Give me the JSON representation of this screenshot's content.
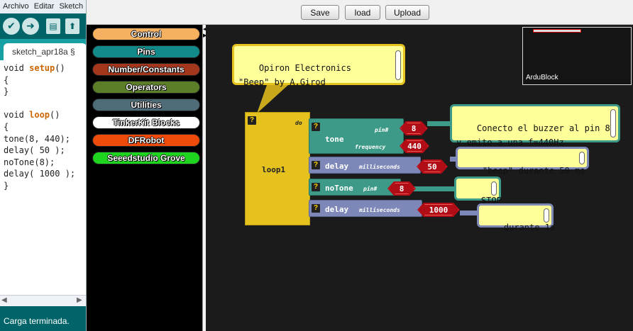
{
  "ide": {
    "menu": [
      "Archivo",
      "Editar",
      "Sketch"
    ],
    "tab_label": "sketch_apr18a §",
    "code_lines": [
      {
        "kw": "",
        "pre": "void ",
        "keyword": "setup",
        "post": "()"
      },
      {
        "plain": "{"
      },
      {
        "plain": "}"
      },
      {
        "plain": ""
      },
      {
        "kw": "",
        "pre": "void ",
        "keyword": "loop",
        "post": "()"
      },
      {
        "plain": "{"
      },
      {
        "plain": "tone(8, 440);"
      },
      {
        "plain": "delay( 50 );"
      },
      {
        "plain": "noTone(8);"
      },
      {
        "plain": "delay( 1000 );"
      },
      {
        "plain": "}"
      }
    ],
    "status": "Carga terminada."
  },
  "ardublock": {
    "buttons": {
      "save": "Save",
      "load": "load",
      "upload": "Upload"
    },
    "categories": [
      {
        "label": "Control",
        "color": "#f5b060"
      },
      {
        "label": "Pins",
        "color": "#138a8a"
      },
      {
        "label": "Number/Constants",
        "color": "#a5361e"
      },
      {
        "label": "Operators",
        "color": "#5d7e29"
      },
      {
        "label": "Utilities",
        "color": "#4e6b78"
      },
      {
        "label": "TinkerKit Blocks",
        "color": "#ffffff"
      },
      {
        "label": "DFRobot",
        "color": "#ef4b0a"
      },
      {
        "label": "Seeedstudio Grove",
        "color": "#1ed41e"
      }
    ],
    "minimap_label": "ArduBlock",
    "qmark": "?",
    "loop": {
      "label": "loop1",
      "do": "do"
    },
    "tone": {
      "label": "tone",
      "pin_label": "pin#",
      "freq_label": "frequency",
      "pin": "8",
      "freq": "440"
    },
    "delay1": {
      "label": "delay",
      "param_label": "milliseconds",
      "value": "50"
    },
    "notone": {
      "label": "noTone",
      "pin_label": "pin#",
      "pin": "8"
    },
    "delay2": {
      "label": "delay",
      "param_label": "milliseconds",
      "value": "1000"
    },
    "comments": {
      "header": "Opiron Electronics\n\"Beep\" by A.Girod",
      "tone": "Conecto el buzzer al pin 8,\ny emito a una f=440Hz",
      "delay1": "\"beep\" durante 50 ms",
      "notone": "STOP",
      "delay2": "durante 1s"
    },
    "colors": {
      "control": "#e6c21f",
      "pins": "#3d9a88",
      "utilities": "#7d88b8",
      "number": "#b00d17"
    }
  }
}
